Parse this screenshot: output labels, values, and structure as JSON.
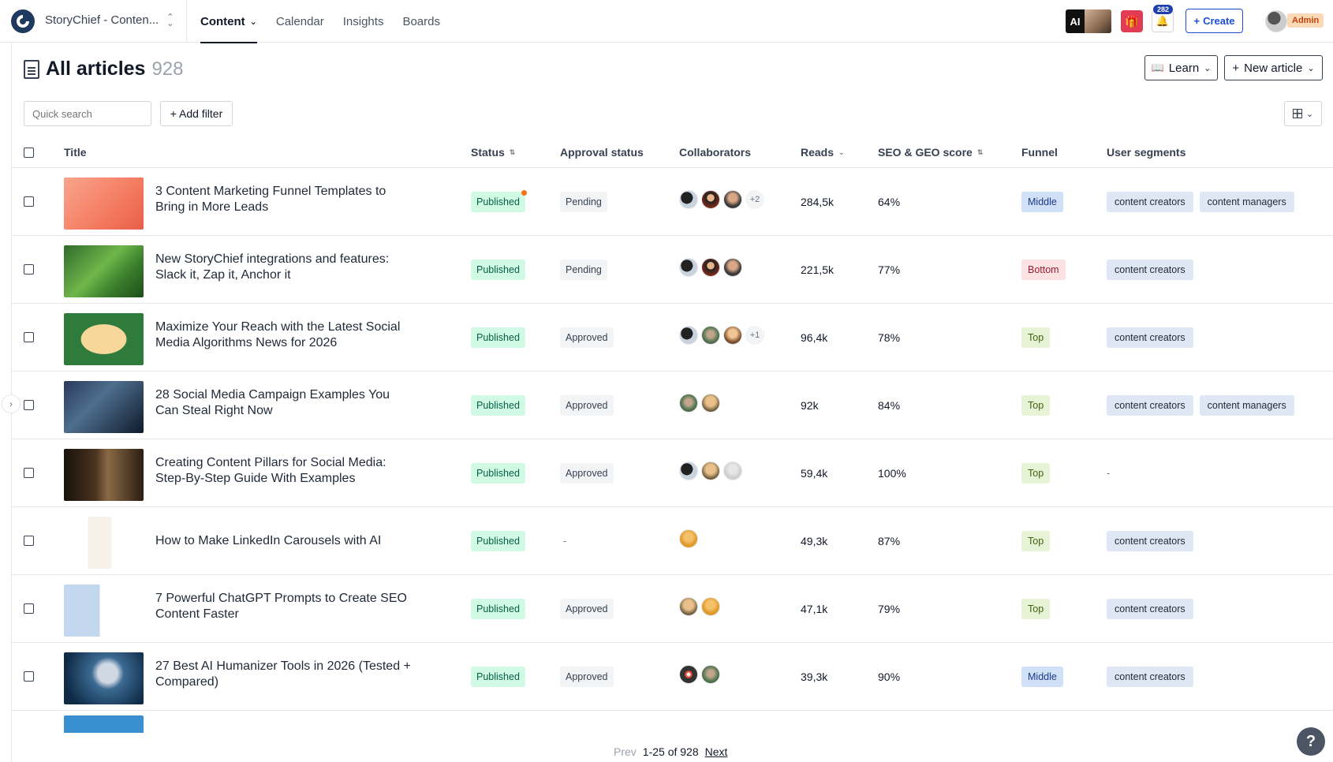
{
  "topbar": {
    "workspace": "StoryChief - Conten...",
    "nav": [
      {
        "label": "Content",
        "active": true
      },
      {
        "label": "Calendar"
      },
      {
        "label": "Insights"
      },
      {
        "label": "Boards"
      }
    ],
    "ai_label": "AI",
    "notification_count": "282",
    "create_label": "Create",
    "role_badge": "Admin",
    "colors": {
      "brand": "#1f3a5f",
      "create": "#1d4ed8",
      "gift": "#e23c54",
      "badge": "#1e40af"
    }
  },
  "header": {
    "title": "All articles",
    "count": "928",
    "learn_label": "Learn",
    "new_label": "New article",
    "search_placeholder": "Quick search",
    "add_filter_label": "+ Add filter"
  },
  "columns": {
    "title": "Title",
    "status": "Status",
    "approval": "Approval status",
    "collaborators": "Collaborators",
    "reads": "Reads",
    "seo": "SEO & GEO score",
    "funnel": "Funnel",
    "segments": "User segments"
  },
  "rows": [
    {
      "title": "3 Content Marketing Funnel Templates to Bring in More Leads",
      "status": "Published",
      "approval": "Pending",
      "collab_more": "+2",
      "reads": "284,5k",
      "seo": "64%",
      "funnel": "Middle",
      "segments": [
        "content creators",
        "content managers"
      ]
    },
    {
      "title": "New StoryChief integrations and features: Slack it, Zap it, Anchor it",
      "status": "Published",
      "approval": "Pending",
      "collab_more": "",
      "reads": "221,5k",
      "seo": "77%",
      "funnel": "Bottom",
      "segments": [
        "content creators"
      ]
    },
    {
      "title": "Maximize Your Reach with the Latest Social Media Algorithms News for 2026",
      "status": "Published",
      "approval": "Approved",
      "collab_more": "+1",
      "reads": "96,4k",
      "seo": "78%",
      "funnel": "Top",
      "segments": [
        "content creators"
      ]
    },
    {
      "title": "28 Social Media Campaign Examples You Can Steal Right Now",
      "status": "Published",
      "approval": "Approved",
      "collab_more": "",
      "reads": "92k",
      "seo": "84%",
      "funnel": "Top",
      "segments": [
        "content creators",
        "content managers"
      ]
    },
    {
      "title": "Creating Content Pillars for Social Media: Step-By-Step Guide With Examples",
      "status": "Published",
      "approval": "Approved",
      "collab_more": "",
      "reads": "59,4k",
      "seo": "100%",
      "funnel": "Top",
      "segments": [],
      "segments_empty": "-"
    },
    {
      "title": "How to Make LinkedIn Carousels with AI",
      "status": "Published",
      "approval": "-",
      "collab_more": "",
      "reads": "49,3k",
      "seo": "87%",
      "funnel": "Top",
      "segments": [
        "content creators"
      ]
    },
    {
      "title": "7 Powerful ChatGPT Prompts to Create SEO Content Faster",
      "status": "Published",
      "approval": "Approved",
      "collab_more": "",
      "reads": "47,1k",
      "seo": "79%",
      "funnel": "Top",
      "segments": [
        "content creators"
      ]
    },
    {
      "title": "27 Best AI Humanizer Tools in 2026 (Tested + Compared)",
      "status": "Published",
      "approval": "Approved",
      "collab_more": "",
      "reads": "39,3k",
      "seo": "90%",
      "funnel": "Middle",
      "segments": [
        "content creators"
      ]
    }
  ],
  "pager": {
    "prev": "Prev",
    "range": "1-25 of 928",
    "next": "Next"
  },
  "help_label": "?"
}
